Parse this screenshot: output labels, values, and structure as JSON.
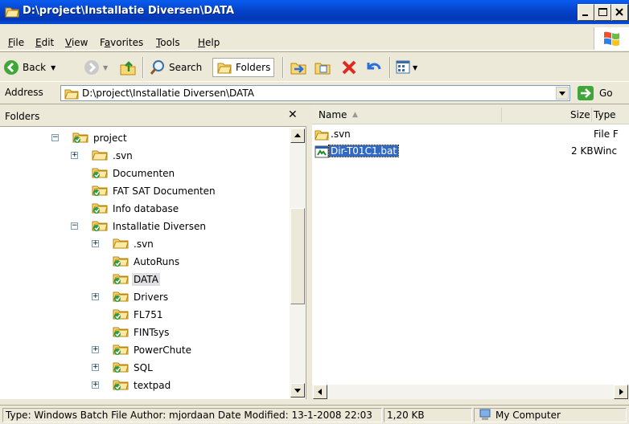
{
  "window": {
    "title": "D:\\project\\Installatie Diversen\\DATA"
  },
  "menu": [
    {
      "label": "File",
      "underline": "F",
      "rest": "ile"
    },
    {
      "label": "Edit",
      "underline": "E",
      "rest": "dit"
    },
    {
      "label": "View",
      "underline": "V",
      "rest": "iew"
    },
    {
      "label": "Favorites",
      "underline": "a",
      "pre": "F",
      "rest": "vorites"
    },
    {
      "label": "Tools",
      "underline": "T",
      "rest": "ools"
    },
    {
      "label": "Help",
      "underline": "H",
      "rest": "elp"
    }
  ],
  "toolbar": {
    "back_label": "Back",
    "search_label": "Search",
    "folders_label": "Folders"
  },
  "address": {
    "label": "Address",
    "value": "D:\\project\\Installatie Diversen\\DATA",
    "go_label": "Go"
  },
  "folders_pane": {
    "title": "Folders",
    "tree": [
      {
        "label": "project",
        "level": 0,
        "expander": "minus"
      },
      {
        "label": ".svn",
        "level": 1,
        "expander": "plus",
        "icon": "plain-folder"
      },
      {
        "label": "Documenten",
        "level": 1,
        "expander": ""
      },
      {
        "label": "FAT SAT Documenten",
        "level": 1,
        "expander": ""
      },
      {
        "label": "Info database",
        "level": 1,
        "expander": ""
      },
      {
        "label": "Installatie Diversen",
        "level": 1,
        "expander": "minus"
      },
      {
        "label": ".svn",
        "level": 2,
        "expander": "plus",
        "icon": "plain-folder"
      },
      {
        "label": "AutoRuns",
        "level": 2,
        "expander": ""
      },
      {
        "label": "DATA",
        "level": 2,
        "expander": "",
        "selected": true
      },
      {
        "label": "Drivers",
        "level": 2,
        "expander": "plus"
      },
      {
        "label": "FL751",
        "level": 2,
        "expander": ""
      },
      {
        "label": "FINTsys",
        "level": 2,
        "expander": ""
      },
      {
        "label": "PowerChute",
        "level": 2,
        "expander": "plus"
      },
      {
        "label": "SQL",
        "level": 2,
        "expander": "plus"
      },
      {
        "label": "textpad",
        "level": 2,
        "expander": "plus"
      }
    ]
  },
  "files_pane": {
    "columns": {
      "name": "Name",
      "size": "Size",
      "type": "Type"
    },
    "files": [
      {
        "name": ".svn",
        "size": "",
        "type": "File F",
        "icon": "folder-icon"
      },
      {
        "name": "Dir-T01C1.bat",
        "size": "2 KB",
        "type": "Winc",
        "icon": "batch-file-icon",
        "selected": true
      }
    ]
  },
  "status": {
    "description": "Type: Windows Batch File Author: mjordaan Date Modified: 13-1-2008 22:03",
    "size": "1,20 KB",
    "zone": "My Computer"
  },
  "colors": {
    "title_bar": "#0542c9",
    "selection": "#316ac5",
    "chrome": "#ece9d8"
  }
}
